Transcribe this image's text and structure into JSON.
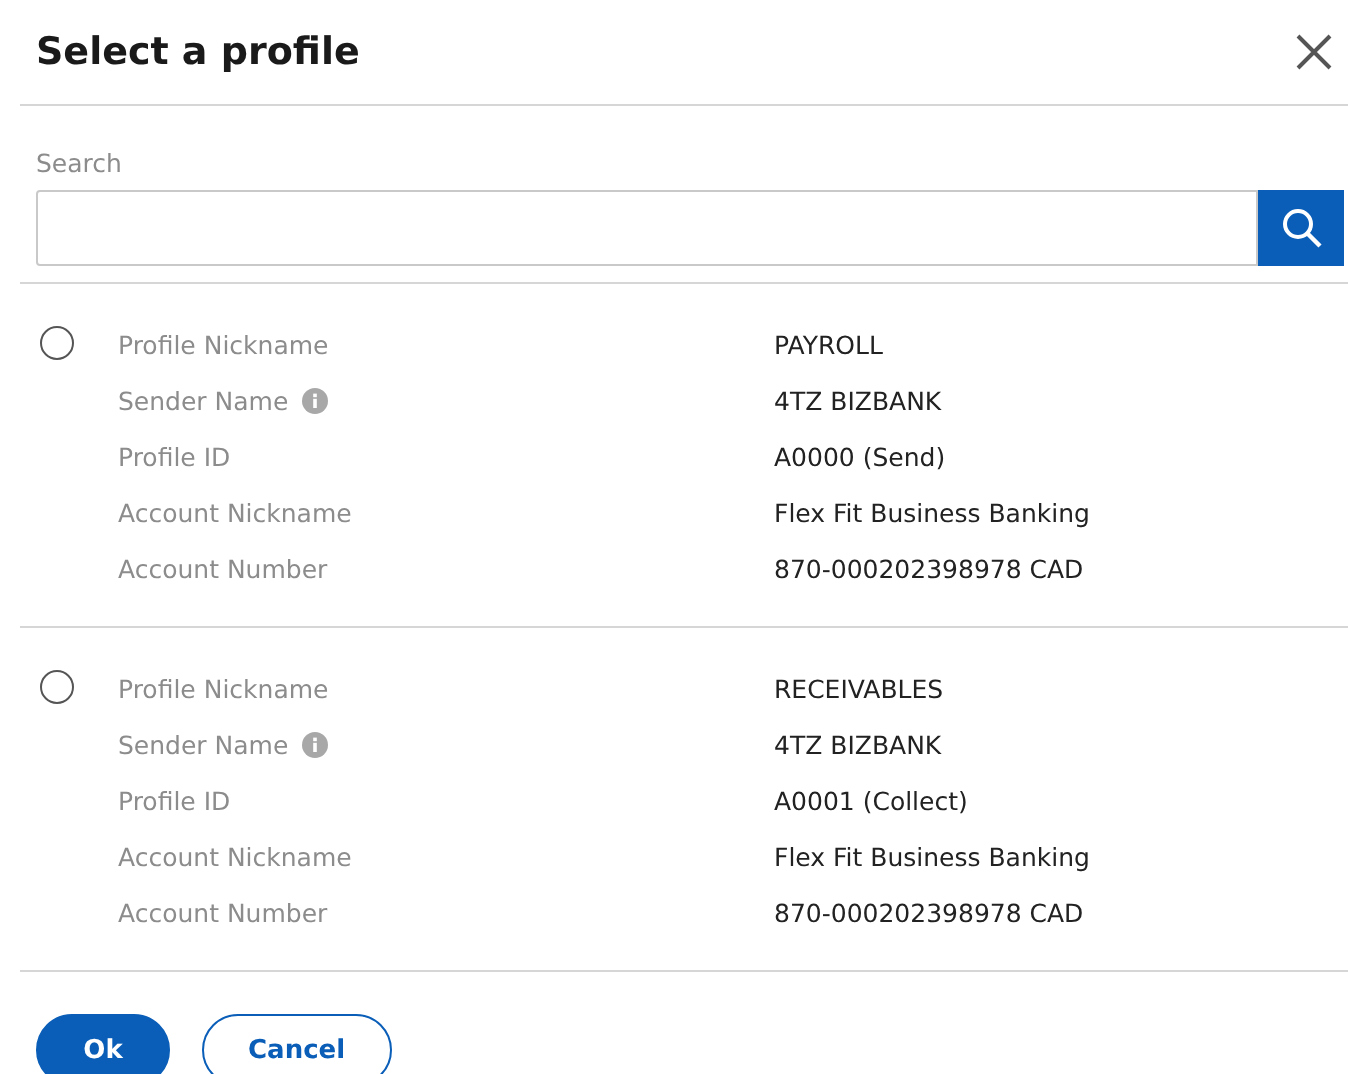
{
  "dialog": {
    "title": "Select a profile"
  },
  "search": {
    "label": "Search"
  },
  "profiles": [
    {
      "selected": false,
      "fields": [
        {
          "label": "Profile Nickname",
          "value": "PAYROLL",
          "info": false
        },
        {
          "label": "Sender Name",
          "value": "4TZ BIZBANK",
          "info": true
        },
        {
          "label": "Profile ID",
          "value": "A0000 (Send)",
          "info": false
        },
        {
          "label": "Account Nickname",
          "value": "Flex Fit Business Banking",
          "info": false
        },
        {
          "label": "Account Number",
          "value": "870-000202398978 CAD",
          "info": false
        }
      ]
    },
    {
      "selected": false,
      "fields": [
        {
          "label": "Profile Nickname",
          "value": "RECEIVABLES",
          "info": false
        },
        {
          "label": "Sender Name",
          "value": "4TZ BIZBANK",
          "info": true
        },
        {
          "label": "Profile ID",
          "value": "A0001 (Collect)",
          "info": false
        },
        {
          "label": "Account Nickname",
          "value": "Flex Fit Business Banking",
          "info": false
        },
        {
          "label": "Account Number",
          "value": "870-000202398978 CAD",
          "info": false
        }
      ]
    }
  ],
  "buttons": [
    {
      "label": "Ok",
      "kind": "primary"
    },
    {
      "label": "Cancel",
      "kind": "secondary"
    }
  ]
}
